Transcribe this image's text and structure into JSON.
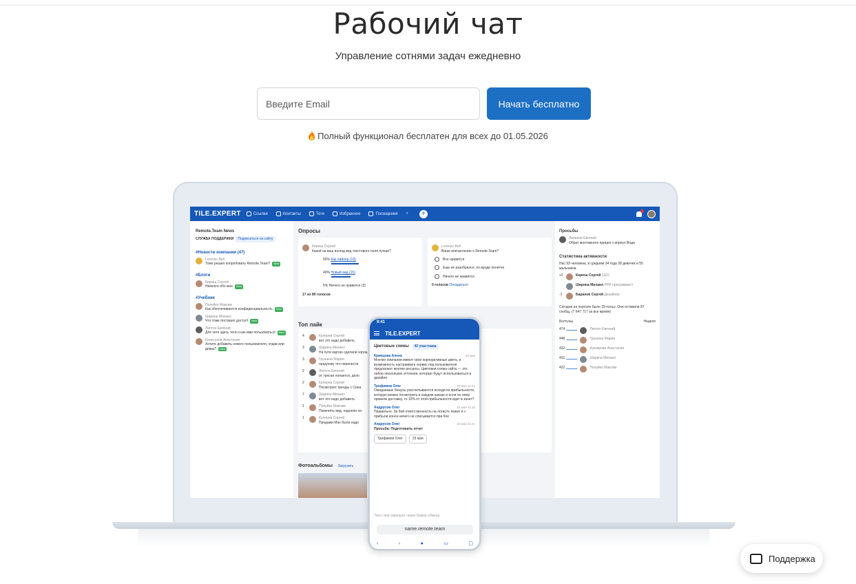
{
  "hero": {
    "title": "Рабочий чат",
    "subtitle": "Управление сотнями задач ежедневно",
    "email_placeholder": "Введите Email",
    "cta_label": "Начать бесплатно",
    "promo": "Полный функционал бесплатен для всех до 01.05.2026",
    "promo_icon": "fire-icon"
  },
  "app": {
    "logo": "TILE.EXPERT",
    "nav": [
      "Ссылки",
      "Контакты",
      "Теги",
      "Избранное",
      "Посещения"
    ],
    "left": {
      "news_title": "Remote.Team News",
      "support_label": "СЛУЖБА ПОДДЕРЖКИ",
      "subscribe": "Подписаться на сайту",
      "section1": "#Новости компании (47)",
      "s1_author": "Lorenzo Bell",
      "s1_text": "Тоже решил попробовать Remote.Team?",
      "section2": "#Блоги",
      "s2_author": "Кирюш Сергей",
      "s2_text": "Немного обо мне",
      "section3": "#Учебник",
      "s3_items": [
        {
          "author": "Полуйко Максим",
          "text": "Как обеспечивается конфиденциальность"
        },
        {
          "author": "Шарина Михаил",
          "text": "Что тоже поставил доступ!"
        },
        {
          "author": "Липтон Евгений",
          "text": "Для чего здесь теги и как ими пользоваться"
        },
        {
          "author": "Колесулов Анастасия",
          "text": "Хотите добавить нового пользователя, отдав или девиз?"
        }
      ],
      "new_badge": "New"
    },
    "mid": {
      "polls_title": "Опросы",
      "poll1_author": "Кирюш Сергей",
      "poll1_q": "Какой на ваш взгляд вид текстового поля лучше?",
      "poll1_opts": [
        {
          "pct": "56%",
          "label": "Как лайнер (19)"
        },
        {
          "pct": "40%",
          "label": "Новый вид (15)"
        },
        {
          "pct": "5%",
          "label": "Ничего не нравится (3)"
        }
      ],
      "poll1_total": "17 из 89 голосов",
      "poll2_author": "Lorenzo Bell",
      "poll2_q": "Ваше впечатление о Remote.Team?",
      "poll2_opts": [
        "Все нравится",
        "Еще не разобрался, но вроде понятно",
        "Ничего не нравится"
      ],
      "poll2_total": "0 голосов",
      "poll2_link": "Опоздаться",
      "top_likes_title": "Топ лайк",
      "likes": [
        {
          "n": "4",
          "author": "Кулерев Сергей",
          "text": "вот это надо добавить"
        },
        {
          "n": "3",
          "author": "Шарина Михаил",
          "text": "На пути картах сделали хорошо"
        },
        {
          "n": "3",
          "author": "Грушина Мария",
          "text": "предложу что перенести"
        },
        {
          "n": "2",
          "author": "Липтон Евгений",
          "text": "от трясни лопается, дело"
        },
        {
          "n": "2",
          "author": "Кулерев Сергей",
          "text": "Посмотрел тренды с Сина"
        },
        {
          "n": "7",
          "author": "Шарина Михаил",
          "text": "вот это надо добавить"
        },
        {
          "n": "1",
          "author": "Полуйко Максим",
          "text": "Поменять вид, надоели на"
        },
        {
          "n": "1",
          "author": "Кулерев Сергей",
          "text": "Продажи Мах были надо"
        }
      ],
      "photos_title": "Фотоальбомы",
      "photos_link": "Загрузить"
    },
    "right": {
      "requests_title": "Просьбы",
      "req_author": "Липинов Евгений",
      "req_text": "Обрат монтажного прицел з апреул Вода",
      "stats_title": "Статистика активности",
      "stats_text": "Нас 93 человека, в средним 34 года 38 девочек и 55 мальчиков",
      "stats_rows": [
        {
          "delta": "+2",
          "name": "Кирюш Сергей",
          "role": "CEO"
        },
        {
          "delta": "",
          "name": "Шарина Михаил",
          "role": "PHP программист"
        },
        {
          "delta": "-1",
          "name": "Баранов Сергей",
          "role": "Дизайнер"
        }
      ],
      "online_text": "Сегодня на портале было 29 польз. Они оставили 87 сообщ. (7 647 717 за все время)",
      "rating_label": "Болтуны",
      "rating_period": "Неделя",
      "rating": [
        {
          "n": "474",
          "name": "Липтон Евгений"
        },
        {
          "n": "448",
          "name": "Грушина Мария"
        },
        {
          "n": "432",
          "name": "Кукнярова Анастасия"
        },
        {
          "n": "431",
          "name": "Шарина Михаил"
        },
        {
          "n": "422",
          "name": "Полуйко Максим"
        }
      ]
    }
  },
  "phone": {
    "time": "9:41",
    "logo": "TILE.EXPERT",
    "chat_title": "Цветовые схемы",
    "chat_members": "42 участника",
    "messages": [
      {
        "author": "Кривцова Алена",
        "time": "23 мая",
        "text": "Многие компании имеют свои корпоративные цвета, и возможность настраивать сервис под пользователя предлагают многие ресурсы. Цветовая схема сайта — это набор нескольких оттенков, которые будут использоваться в дизайне."
      },
      {
        "author": "Трофимов Олег",
        "time": "23 мая 11:21",
        "text": "Ожидаемые бонусы рассчитываются исходя из прибыльности, которую можно посмотреть в каждом заказе и если по нему провели доставку, то 10% от этой прибыльности идет в зачет?"
      },
      {
        "author": "Андрусов Олег",
        "time": "23 мая 11:22",
        "text": "Правильно. За бой ответственность на логисте лежит и с прибыли конса ничего не списывается при бое"
      },
      {
        "author": "Андрусов Олег",
        "time": "23 мая 11:21",
        "text": "Просьба: Подготовить отчет"
      }
    ],
    "assignee": "Трофимов Олег",
    "deadline": "23 мая",
    "input_placeholder": "Текст или скриншот через буфер обмена",
    "url": "name.remote.team"
  },
  "support": {
    "label": "Поддержка",
    "icon": "chat-icon"
  }
}
